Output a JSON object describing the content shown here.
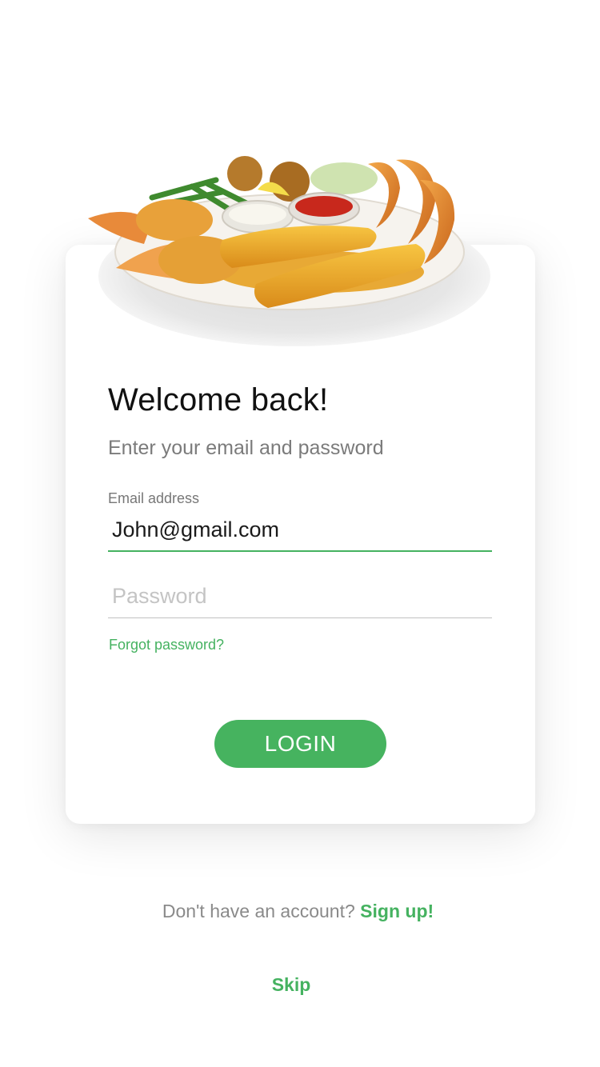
{
  "hero_image": {
    "alt": "Seafood platter"
  },
  "login_card": {
    "title": "Welcome back!",
    "subtitle": "Enter your email and password",
    "email": {
      "label": "Email address",
      "value": "John@gmail.com"
    },
    "password": {
      "placeholder": "Password",
      "value": ""
    },
    "forgot_password": "Forgot password?",
    "login_button": "LOGIN"
  },
  "footer": {
    "signup_prompt": "Don't have an account?",
    "signup_link": "Sign up!",
    "skip": "Skip"
  },
  "colors": {
    "accent": "#46b35f",
    "text_muted": "#7b7b7b"
  }
}
